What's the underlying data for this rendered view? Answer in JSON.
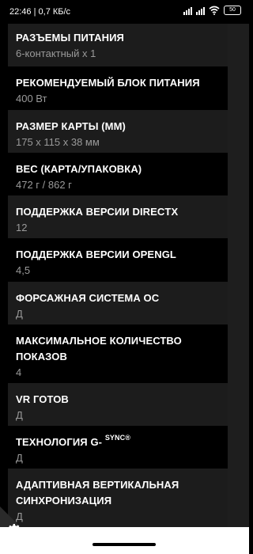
{
  "status": {
    "time": "22:46",
    "speed": "0,7 КБ/с",
    "battery": "50"
  },
  "specs": [
    {
      "label": "РАЗЪЕМЫ ПИТАНИЯ",
      "value": "6-контактный x 1"
    },
    {
      "label": "РЕКОМЕНДУЕМЫЙ БЛОК ПИТАНИЯ",
      "value": "400 Вт"
    },
    {
      "label": "РАЗМЕР КАРТЫ (ММ)",
      "value": "175 x 115 x 38 мм"
    },
    {
      "label": "ВЕС (КАРТА/УПАКОВКА)",
      "value": "472 г / 862 г"
    },
    {
      "label": "ПОДДЕРЖКА ВЕРСИИ DIRECTX",
      "value": "12"
    },
    {
      "label": "ПОДДЕРЖКА ВЕРСИИ OPENGL",
      "value": "4,5"
    },
    {
      "label": "ФОРСАЖНАЯ СИСТЕМА ОС",
      "value": "Д"
    },
    {
      "label": "МАКСИМАЛЬНОЕ КОЛИЧЕСТВО ПОКАЗОВ",
      "value": "4"
    },
    {
      "label": "VR ГОТОВ",
      "value": "Д"
    },
    {
      "label": "ТЕХНОЛОГИЯ G-",
      "label_sup": "SYNC®",
      "value": "Д"
    },
    {
      "label": "АДАПТИВНАЯ ВЕРТИКАЛЬНАЯ СИНХРОНИЗАЦИЯ",
      "value": "Д"
    }
  ],
  "icons": {
    "settings": "gear-icon"
  }
}
